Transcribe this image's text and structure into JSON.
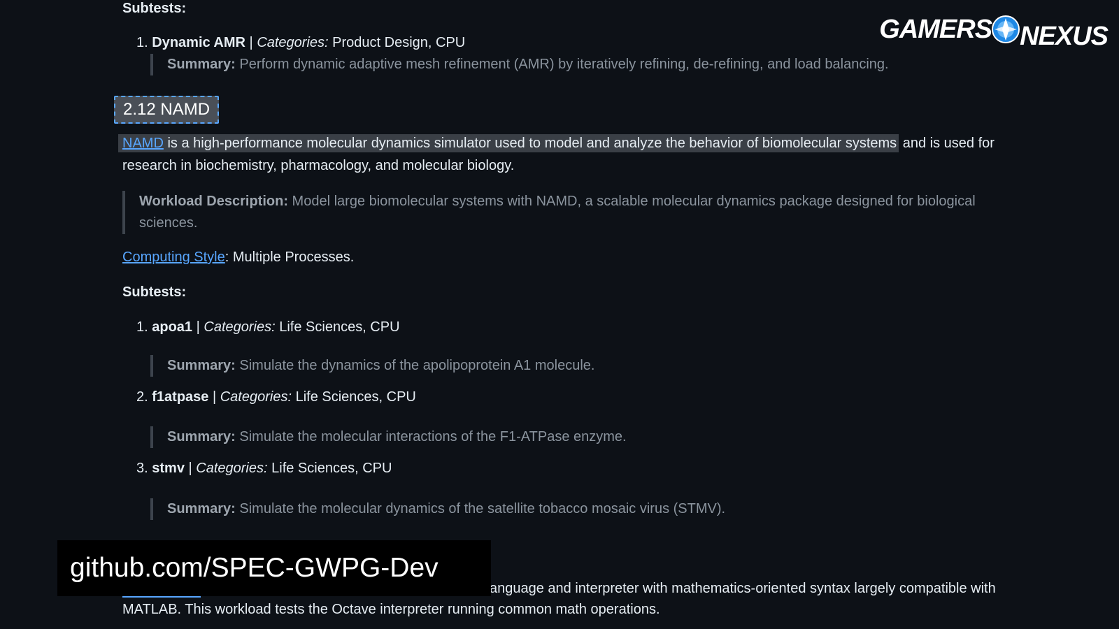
{
  "top_section": {
    "subtests_label": "Subtests:",
    "item1": {
      "number": "1.",
      "name": "Dynamic AMR",
      "separator": "|",
      "categories_label": "Categories:",
      "categories": "Product Design, CPU",
      "summary_label": "Summary:",
      "summary": "Perform dynamic adaptive mesh refinement (AMR) by iteratively refining, de-refining, and load balancing."
    }
  },
  "namd": {
    "heading": "2.12 NAMD",
    "intro_link": "NAMD",
    "intro_highlighted": " is a high-performance molecular dynamics simulator used to model and analyze the behavior of biomolecular systems",
    "intro_rest": " and is used for",
    "intro_line2": "research in biochemistry, pharmacology, and molecular biology.",
    "workload_label": "Workload Description:",
    "workload_line1": " Model large biomolecular systems with NAMD, a scalable molecular dynamics package designed for biological",
    "workload_line2": "sciences.",
    "computing_style_link": "Computing Style",
    "computing_style_value": ": Multiple Processes.",
    "subtests_label": "Subtests:",
    "subtests": [
      {
        "number": "1.",
        "name": "apoa1",
        "separator": "|",
        "categories_label": "Categories:",
        "categories": "Life Sciences, CPU",
        "summary_label": "Summary:",
        "summary": "Simulate the dynamics of the apolipoprotein A1 molecule."
      },
      {
        "number": "2.",
        "name": "f1atpase",
        "separator": "|",
        "categories_label": "Categories:",
        "categories": "Life Sciences, CPU",
        "summary_label": "Summary:",
        "summary": "Simulate the molecular interactions of the F1-ATPase enzyme."
      },
      {
        "number": "3.",
        "name": "stmv",
        "separator": "|",
        "categories_label": "Categories:",
        "categories": "Life Sciences, CPU",
        "summary_label": "Summary:",
        "summary": "Simulate the molecular dynamics of the satellite tobacco mosaic virus (STMV)."
      }
    ]
  },
  "octave_partial": {
    "line1": "anguage and interpreter with mathematics-oriented syntax largely compatible with",
    "line2": "MATLAB. This workload tests the Octave interpreter running common math operations."
  },
  "overlay": {
    "logo_word1": "GAMERS",
    "logo_word2": "NEXUS",
    "banner_text": "github.com/SPEC-GWPG-Dev"
  },
  "colors": {
    "background": "#0d1117",
    "link": "#58a6ff",
    "muted_text": "#8b949e",
    "heading_box": "#4a4f57"
  }
}
